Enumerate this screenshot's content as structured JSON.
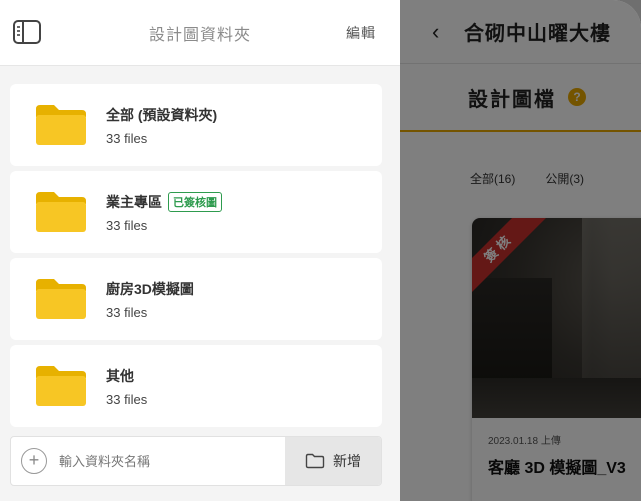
{
  "drawer": {
    "title": "設計圖資料夾",
    "edit_label": "編輯",
    "folders": [
      {
        "name": "全部 (預設資料夾)",
        "count": "33 files",
        "badge": ""
      },
      {
        "name": "業主專區",
        "count": "33 files",
        "badge": "已簽核圖"
      },
      {
        "name": "廚房3D模擬圖",
        "count": "33 files",
        "badge": ""
      },
      {
        "name": "其他",
        "count": "33 files",
        "badge": ""
      }
    ],
    "new_folder": {
      "placeholder": "輸入資料夾名稱",
      "button_label": "新增"
    }
  },
  "background_page": {
    "back_icon": "chevron-left-icon",
    "title": "合砌中山曜大樓",
    "section_title": "設計圖檔",
    "tabs": [
      "全部(16)",
      "公開(3)"
    ],
    "card": {
      "ribbon": "簽核",
      "date": "2023.01.18 上傳",
      "name": "客廳 3D 模擬圖_V3"
    }
  },
  "colors": {
    "folder_yellow": "#f7c624",
    "accent": "#e9a800",
    "badge_green": "#2e9b4e",
    "ribbon_red": "#c9302c"
  }
}
